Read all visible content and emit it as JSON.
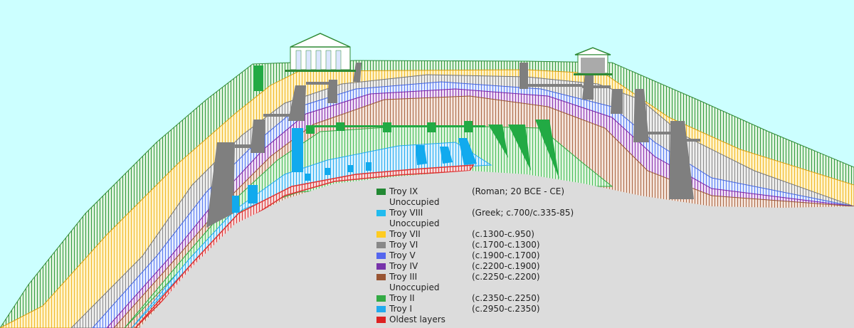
{
  "colors": {
    "sky": "#ccffff",
    "bedrock": "#dcdcdc",
    "troy_ix": "#33aa33",
    "troy_viii": "#22bbee",
    "troy_vii": "#ffcc33",
    "troy_vi": "#888888",
    "troy_v": "#5577ee",
    "troy_iv": "#8833aa",
    "troy_iii": "#aa6644",
    "troy_ii": "#33aa44",
    "troy_i": "#22aaee",
    "oldest": "#dd3333"
  },
  "legend": [
    {
      "name": "Troy IX",
      "dates": "(Roman; 20 BCE - CE)",
      "color": "#228833"
    },
    {
      "name": "Unoccupied",
      "dates": "",
      "color": ""
    },
    {
      "name": "Troy VIII",
      "dates": "(Greek; c.700/c.335-85)",
      "color": "#22bbee"
    },
    {
      "name": "Unoccupied",
      "dates": "",
      "color": ""
    },
    {
      "name": "Troy VII",
      "dates": "(c.1300-c.950)",
      "color": "#ffcc22"
    },
    {
      "name": "Troy VI",
      "dates": "(c.1700-c.1300)",
      "color": "#888888"
    },
    {
      "name": "Troy V",
      "dates": "(c.1900-c.1700)",
      "color": "#5566ee"
    },
    {
      "name": "Troy IV",
      "dates": "(c.2200-c.1900)",
      "color": "#7733aa"
    },
    {
      "name": "Troy III",
      "dates": "(c.2250-c.2200)",
      "color": "#995533"
    },
    {
      "name": "Unoccupied",
      "dates": "",
      "color": ""
    },
    {
      "name": "Troy II",
      "dates": "(c.2350-c.2250)",
      "color": "#33aa44"
    },
    {
      "name": "Troy I",
      "dates": "(c.2950-c.2350)",
      "color": "#22aaee"
    },
    {
      "name": "Oldest layers",
      "dates": "",
      "color": "#dd2222"
    }
  ]
}
